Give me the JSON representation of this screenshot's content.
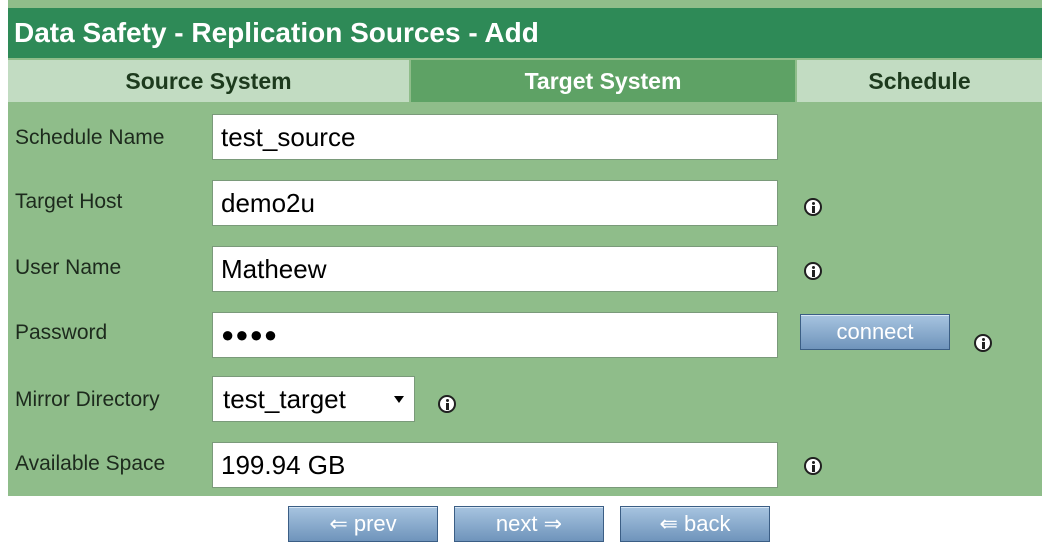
{
  "window": {
    "title": "Data Safety - Replication Sources - Add"
  },
  "tabs": [
    {
      "label": "Source System"
    },
    {
      "label": "Target System",
      "active": true
    },
    {
      "label": "Schedule"
    }
  ],
  "form": {
    "schedule_name": {
      "label": "Schedule Name",
      "value": "test_source"
    },
    "target_host": {
      "label": "Target Host",
      "value": "demo2u"
    },
    "user_name": {
      "label": "User Name",
      "value": "Matheew"
    },
    "password": {
      "label": "Password",
      "value": "●●●●"
    },
    "mirror_directory": {
      "label": "Mirror Directory",
      "value": "test_target"
    },
    "available_space": {
      "label": "Available Space",
      "value": "199.94 GB"
    }
  },
  "buttons": {
    "connect": "connect",
    "prev": "⇐ prev",
    "next": "next ⇒",
    "back": "⇚ back"
  },
  "colors": {
    "title_bar": "#2e8a57",
    "panel": "#8fbd8a",
    "tab_active": "#5ea265",
    "tab_inactive": "#c2dcc2",
    "button": "#6f94bb"
  },
  "icons": [
    "info-icon",
    "dropdown-caret-icon"
  ]
}
